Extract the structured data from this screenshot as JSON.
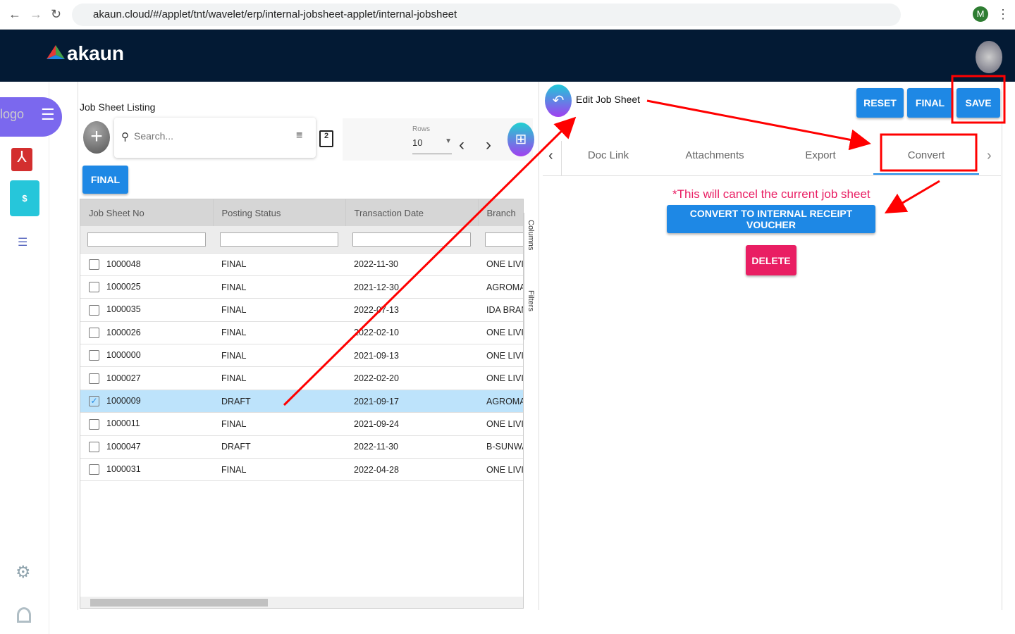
{
  "browser": {
    "url": "akaun.cloud/#/applet/tnt/wavelet/erp/internal-jobsheet-applet/internal-jobsheet",
    "profile": "M"
  },
  "header": {
    "brand": "akaun"
  },
  "sidebar": {
    "logo_alt": "logo"
  },
  "listing": {
    "title": "Job Sheet Listing",
    "search_placeholder": "Search...",
    "rows_label": "Rows",
    "rows_value": "10",
    "final_button": "FINAL",
    "columns": [
      "Job Sheet No",
      "Posting Status",
      "Transaction Date",
      "Branch"
    ],
    "side_tabs": {
      "columns": "Columns",
      "filters": "Filters"
    },
    "rows": [
      {
        "no": "1000048",
        "status": "FINAL",
        "date": "2022-11-30",
        "branch": "ONE LIVING",
        "checked": false
      },
      {
        "no": "1000025",
        "status": "FINAL",
        "date": "2021-12-30",
        "branch": "AGROMART",
        "checked": false
      },
      {
        "no": "1000035",
        "status": "FINAL",
        "date": "2022-07-13",
        "branch": "IDA BRANCH",
        "checked": false
      },
      {
        "no": "1000026",
        "status": "FINAL",
        "date": "2022-02-10",
        "branch": "ONE LIVING",
        "checked": false
      },
      {
        "no": "1000000",
        "status": "FINAL",
        "date": "2021-09-13",
        "branch": "ONE LIVING",
        "checked": false
      },
      {
        "no": "1000027",
        "status": "FINAL",
        "date": "2022-02-20",
        "branch": "ONE LIVING",
        "checked": false
      },
      {
        "no": "1000009",
        "status": "DRAFT",
        "date": "2021-09-17",
        "branch": "AGROMART",
        "checked": true
      },
      {
        "no": "1000011",
        "status": "FINAL",
        "date": "2021-09-24",
        "branch": "ONE LIVING",
        "checked": false
      },
      {
        "no": "1000047",
        "status": "DRAFT",
        "date": "2022-11-30",
        "branch": "B-SUNWAY",
        "checked": false
      },
      {
        "no": "1000031",
        "status": "FINAL",
        "date": "2022-04-28",
        "branch": "ONE LIVING",
        "checked": false
      }
    ]
  },
  "edit": {
    "title": "Edit Job Sheet",
    "reset": "RESET",
    "final": "FINAL",
    "save": "SAVE",
    "tabs": [
      "Doc Link",
      "Attachments",
      "Export",
      "Convert"
    ],
    "active_tab": "Convert",
    "warning": "*This will cancel the current job sheet",
    "convert_button": "CONVERT TO INTERNAL RECEIPT VOUCHER",
    "delete_button": "DELETE"
  },
  "colors": {
    "primary": "#1e88e5",
    "danger": "#e91e63",
    "header": "#031a34",
    "annotation": "#ff0000"
  }
}
